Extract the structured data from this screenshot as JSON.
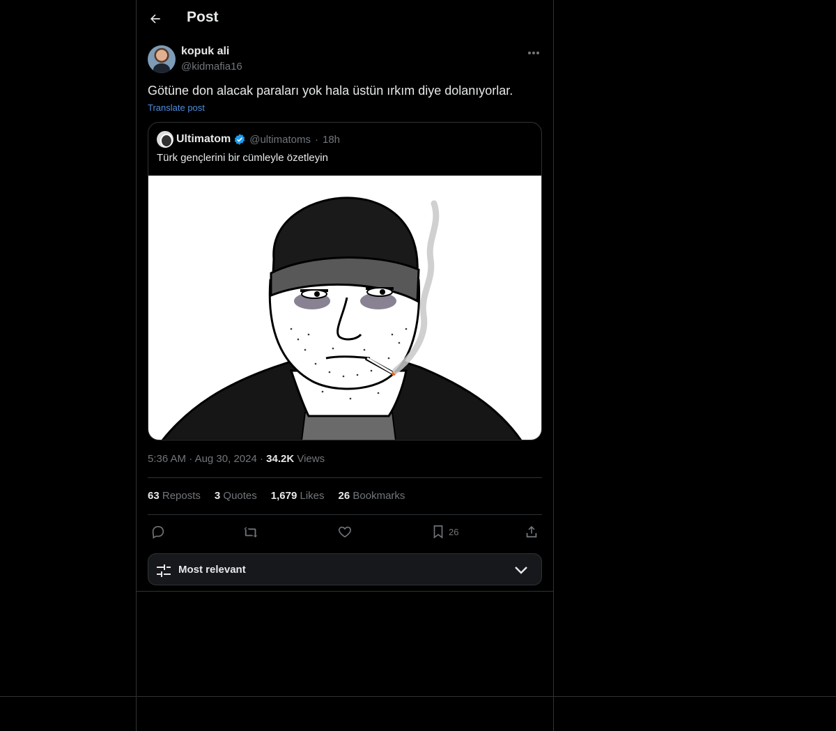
{
  "header": {
    "title": "Post"
  },
  "author": {
    "name": "kopuk ali",
    "handle": "@kidmafia16"
  },
  "post": {
    "text": "Götüne don alacak paraları yok hala üstün ırkım diye dolanıyorlar.",
    "translate_label": "Translate post"
  },
  "quote": {
    "name": "Ultimatom",
    "handle": "@ultimatoms",
    "separator": "·",
    "time": "18h",
    "text": "Türk gençlerini bir cümleyle özetleyin"
  },
  "meta": {
    "time": "5:36 AM",
    "separator": "·",
    "date": "Aug 30, 2024",
    "separator2": "·",
    "views_count": "34.2K",
    "views_label": "Views"
  },
  "stats": [
    {
      "num": "63",
      "label": "Reposts"
    },
    {
      "num": "3",
      "label": "Quotes"
    },
    {
      "num": "1,679",
      "label": "Likes"
    },
    {
      "num": "26",
      "label": "Bookmarks"
    }
  ],
  "actions": {
    "bookmark_count": "26"
  },
  "sort": {
    "label": "Most relevant"
  },
  "colors": {
    "background": "#000000",
    "border": "#2f3336",
    "muted": "#71767b",
    "link": "#4e8ee0",
    "verified": "#1d9bf0"
  }
}
